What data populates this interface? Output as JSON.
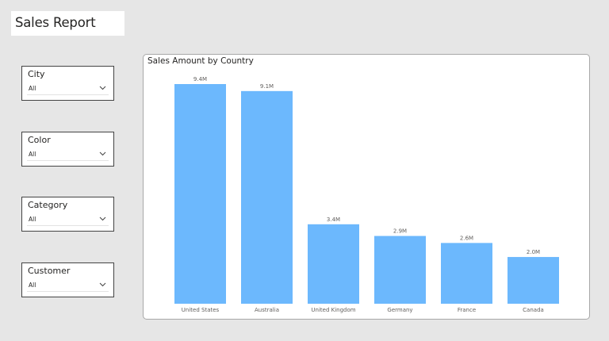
{
  "report": {
    "title": "Sales Report"
  },
  "slicers": [
    {
      "label": "City",
      "value": "All"
    },
    {
      "label": "Color",
      "value": "All"
    },
    {
      "label": "Category",
      "value": "All"
    },
    {
      "label": "Customer",
      "value": "All"
    }
  ],
  "icons": {
    "dropdown": "chevron-down-icon"
  },
  "colors": {
    "bar": "#6cb8fd",
    "background": "#e6e6e6"
  },
  "chart_data": {
    "type": "bar",
    "title": "Sales Amount by Country",
    "categories": [
      "United States",
      "Australia",
      "United Kingdom",
      "Germany",
      "France",
      "Canada"
    ],
    "values": [
      9.4,
      9.1,
      3.4,
      2.9,
      2.6,
      2.0
    ],
    "data_labels": [
      "9.4M",
      "9.1M",
      "3.4M",
      "2.9M",
      "2.6M",
      "2.0M"
    ],
    "ylim": [
      0,
      9.4
    ],
    "grid": false,
    "legend": false,
    "xlabel": "",
    "ylabel": ""
  }
}
